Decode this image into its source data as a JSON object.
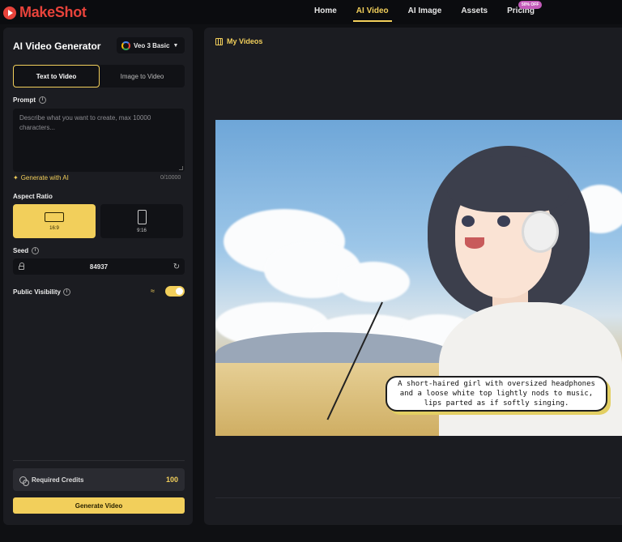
{
  "brand": {
    "name": "MakeShot",
    "accent": "#f2cf5b",
    "logo_color": "#e8433b"
  },
  "nav": {
    "items": [
      "Home",
      "AI Video",
      "AI Image",
      "Assets",
      "Pricing"
    ],
    "active": "AI Video",
    "promo_badge": "50% OFF"
  },
  "generator": {
    "title": "AI Video Generator",
    "model": "Veo 3 Basic",
    "tabs": [
      "Text to Video",
      "Image to Video"
    ],
    "active_tab": "Text to Video",
    "prompt_label": "Prompt",
    "prompt_placeholder": "Describe what you want to create, max 10000 characters...",
    "generate_ai_label": "Generate with AI",
    "char_count": "0/10000",
    "aspect_label": "Aspect Ratio",
    "aspect_options": [
      "16:9",
      "9:16"
    ],
    "aspect_selected": "16:9",
    "seed_label": "Seed",
    "seed_value": "84937",
    "visibility_label": "Public Visibility",
    "visibility_on": true,
    "credits_label": "Required Credits",
    "credits_value": "100",
    "generate_button": "Generate Video"
  },
  "videos": {
    "title": "My Videos",
    "caption": "A short-haired girl with oversized headphones and a loose white top lightly nods to music, lips parted as if softly singing."
  }
}
